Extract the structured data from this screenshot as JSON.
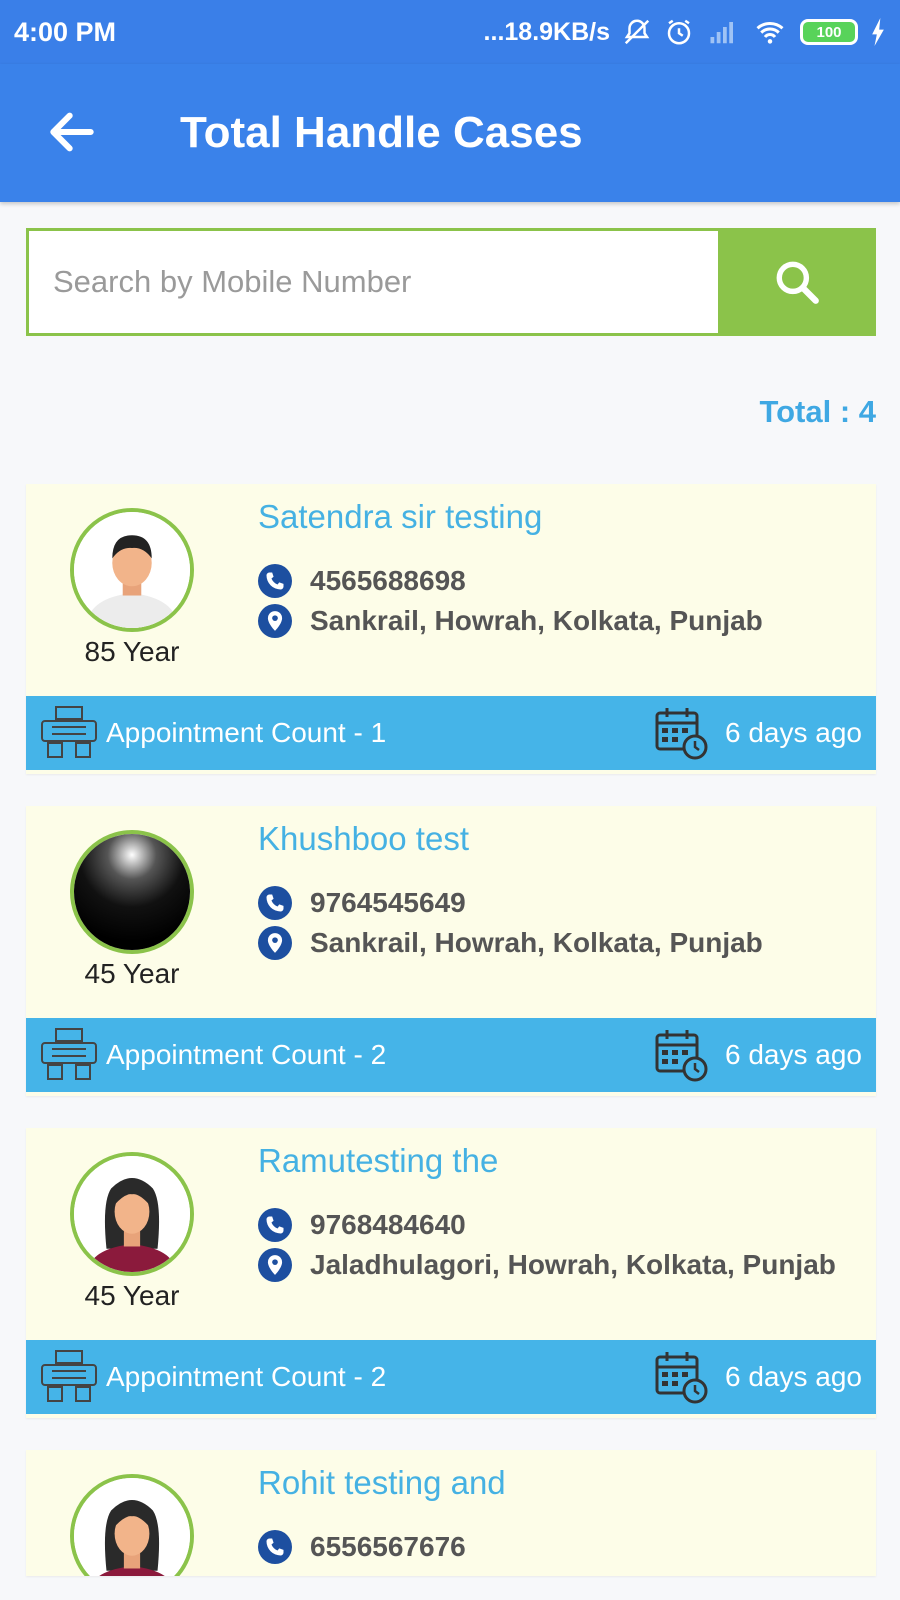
{
  "status": {
    "time": "4:00 PM",
    "network": "...18.9KB/s",
    "battery": "100"
  },
  "header": {
    "title": "Total Handle Cases"
  },
  "search": {
    "placeholder": "Search by Mobile Number",
    "value": ""
  },
  "summary": {
    "total": "Total : 4"
  },
  "cases": [
    {
      "name": "Satendra sir testing",
      "phone": "4565688698",
      "location": "Sankrail, Howrah, Kolkata, Punjab",
      "age": "85 Year",
      "appointments": "Appointment Count - 1",
      "ago": "6 days ago",
      "avatar": "male-avatar"
    },
    {
      "name": "Khushboo test",
      "phone": "9764545649",
      "location": "Sankrail, Howrah, Kolkata, Punjab",
      "age": "45 Year",
      "appointments": "Appointment Count - 2",
      "ago": "6 days ago",
      "avatar": "dark-photo-avatar"
    },
    {
      "name": "Ramutesting the",
      "phone": "9768484640",
      "location": "Jaladhulagori, Howrah, Kolkata, Punjab",
      "age": "45 Year",
      "appointments": "Appointment Count - 2",
      "ago": "6 days ago",
      "avatar": "female-avatar"
    },
    {
      "name": "Rohit testing and",
      "phone": "6556567676",
      "avatar": "female-avatar"
    }
  ],
  "colors": {
    "primary": "#3a82ea",
    "accent_green": "#8bc34a",
    "info_blue": "#45b4e8",
    "card_bg": "#fdfde8",
    "name_blue": "#45b1e3",
    "icon_navy": "#1d4fa0"
  }
}
